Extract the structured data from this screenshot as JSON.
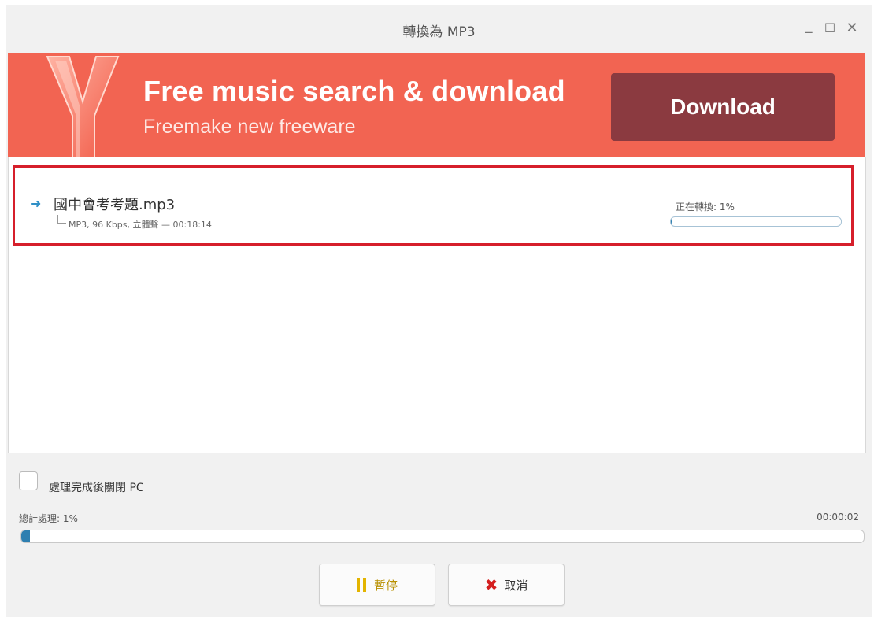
{
  "window": {
    "title": "轉換為 MP3",
    "minimize_glyph": "_",
    "maximize_glyph": "☐",
    "close_glyph": "✕"
  },
  "banner": {
    "logo_icon": "freemake-y-logo",
    "title": "Free music search & download",
    "subtitle": "Freemake new freeware",
    "button_label": "Download",
    "background_color": "#f26452",
    "button_color": "#8b3a40"
  },
  "queue": {
    "items": [
      {
        "icon": "arrow-right-icon",
        "file_name": "國中會考考題.mp3",
        "details": "MP3, 96 Kbps, 立體聲 — 00:18:14",
        "status": "正在轉換: 1%",
        "progress_percent": 1
      }
    ]
  },
  "options": {
    "shutdown_label": "處理完成後關閉 PC",
    "shutdown_checked": false
  },
  "total": {
    "label": "總計處理: 1%",
    "elapsed": "00:00:02",
    "progress_percent": 1
  },
  "buttons": {
    "pause_label": "暫停",
    "cancel_label": "取消"
  },
  "colors": {
    "accent": "#2e7fb0",
    "highlight_border": "#d61f2b",
    "pause": "#e3b400",
    "cancel_x": "#d41f1f"
  }
}
